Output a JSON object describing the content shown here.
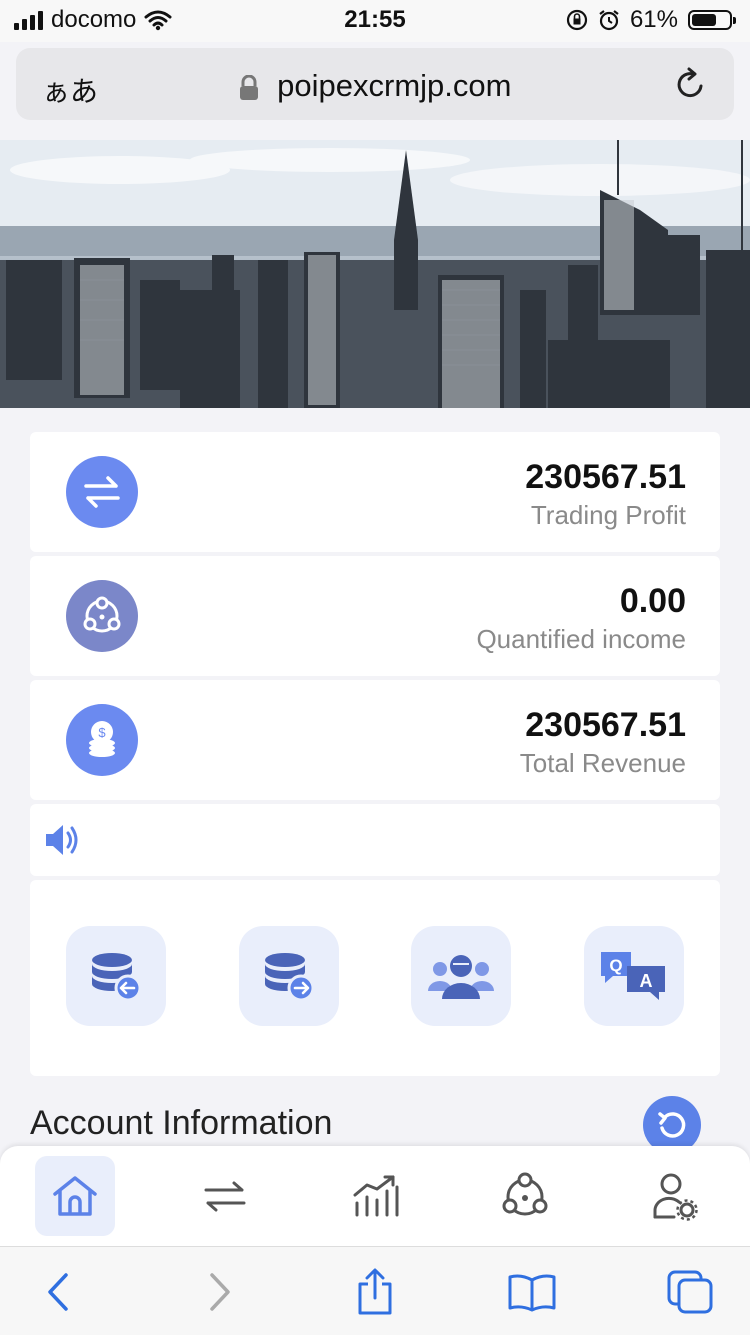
{
  "status_bar": {
    "carrier": "docomo",
    "time": "21:55",
    "battery": "61%"
  },
  "browser": {
    "text_size_label": "ぁあ",
    "url": "poipexcrmjp.com"
  },
  "stats": [
    {
      "value": "230567.51",
      "label": "Trading Profit",
      "icon": "exchange-icon",
      "color": "#6b8af0"
    },
    {
      "value": "0.00",
      "label": "Quantified income",
      "icon": "network-icon",
      "color": "#7b87c9"
    },
    {
      "value": "230567.51",
      "label": "Total Revenue",
      "icon": "coins-icon",
      "color": "#6b8af0"
    }
  ],
  "quick_actions": [
    {
      "icon": "deposit-icon"
    },
    {
      "icon": "withdraw-icon"
    },
    {
      "icon": "team-icon"
    },
    {
      "icon": "faq-icon"
    }
  ],
  "account": {
    "title": "Account Information"
  },
  "tabbar": [
    {
      "icon": "home-icon",
      "active": true
    },
    {
      "icon": "exchange-icon",
      "active": false
    },
    {
      "icon": "chart-icon",
      "active": false
    },
    {
      "icon": "network-icon",
      "active": false
    },
    {
      "icon": "user-settings-icon",
      "active": false
    }
  ],
  "colors": {
    "accent": "#5c82e8",
    "icon_bg": "#e9eefb",
    "muted_text": "#8a8a8a"
  }
}
